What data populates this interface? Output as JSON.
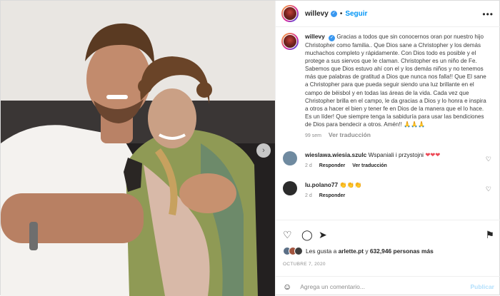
{
  "post": {
    "username": "willevy",
    "follow_label": "Seguir",
    "more_icon": "ellipsis-icon"
  },
  "caption": {
    "username": "willevy",
    "text": "Gracias a todos que sin conocernos oran por nuestro hijo Christopher como familia.. Que Dios sane a Christopher y los demás muchachos completo y rápidamente. Con Dios todo es posible y el protege a sus siervos que le claman. Christopher es un niño de Fe. Sabemos que Dios estuvo ahí con el y los demás niños y no tenemos más que palabras de gratitud a Dios que nunca nos falla!! Que El sane a Christopher para que pueda seguir siendo una luz brillante en el campo de béisbol y en todas las áreas de la vida. Cada vez que Christopher brilla en el campo, le da gracias a Dios y lo honra e inspira a otros a hacer el bien y tener fe en Dios de la manera que el lo hace. Es un líder! Que siempre tenga la sabiduría para usar las bendiciones de Dios para bendecir a otros. Amén!! 🙏🙏🙏",
    "age": "99 sem",
    "translate_label": "Ver traducción"
  },
  "comments": [
    {
      "username": "wieslawa.wiesia.szulc",
      "text": "Wspaniali i przystojni",
      "hearts": "❤❤❤",
      "age": "2 d",
      "reply_label": "Responder",
      "translate_label": "Ver traducción",
      "avatar_color": "#6f8aa0"
    },
    {
      "username": "lu.polano77",
      "text": "👏👏👏",
      "age": "2 d",
      "reply_label": "Responder",
      "avatar_color": "#2b2b2b"
    }
  ],
  "likes": {
    "liked_by_prefix": "Les gusta a",
    "liked_by_user": "arlette.pt",
    "and_label": "y",
    "count_label": "632,946 personas más"
  },
  "date": "OCTUBRE 7, 2020",
  "composer": {
    "placeholder": "Agrega un comentario...",
    "publish_label": "Publicar"
  },
  "colors": {
    "accent": "#0095f6",
    "verified": "#3897f0",
    "heart_red": "#ed4956",
    "publish_disabled": "#b2dffc"
  }
}
